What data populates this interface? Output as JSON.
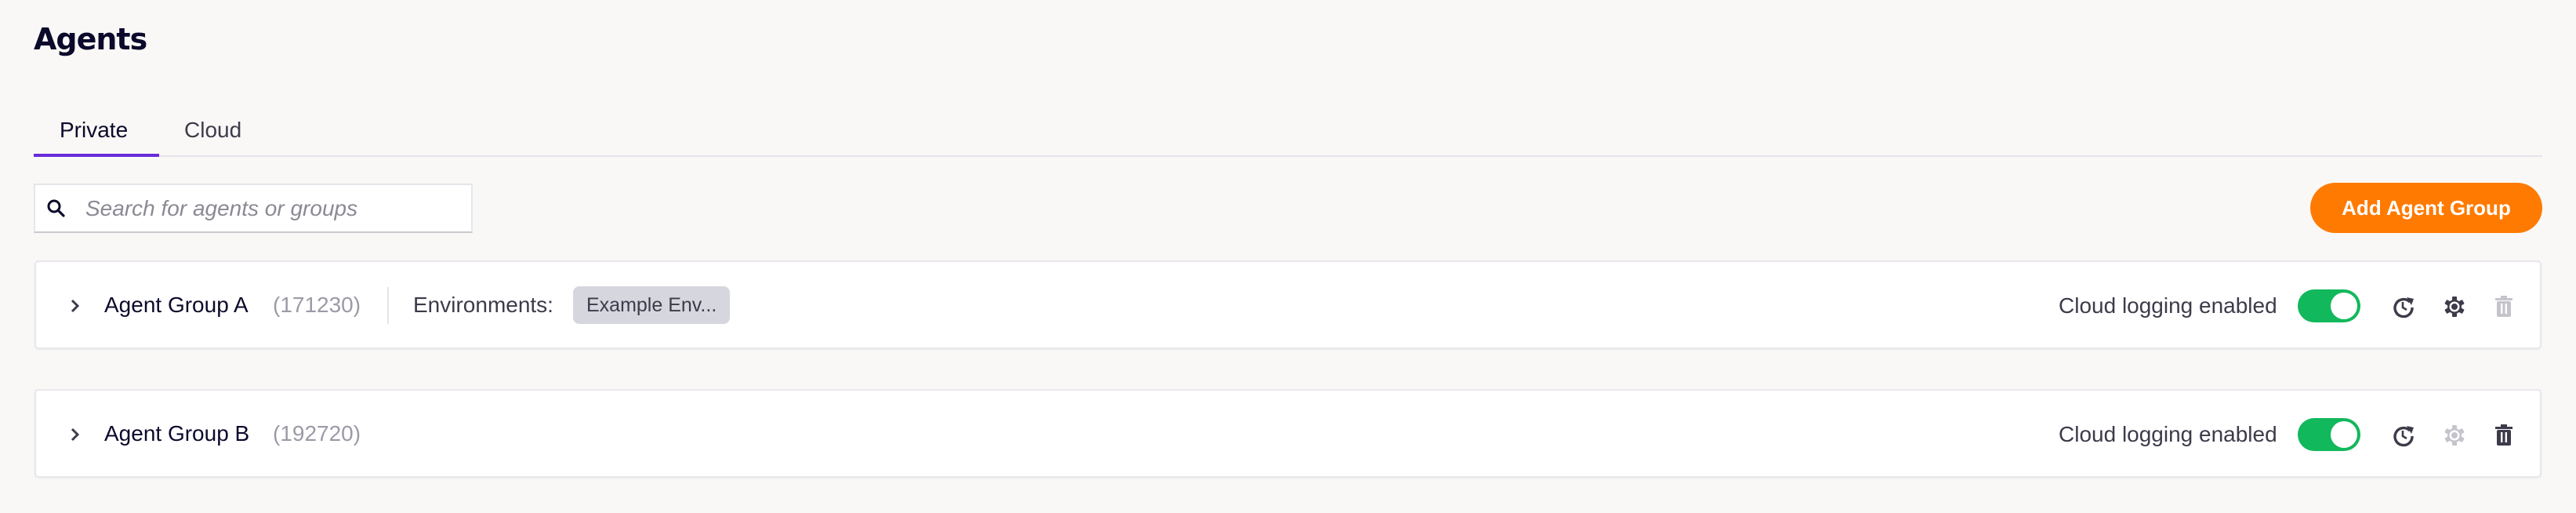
{
  "header": {
    "title": "Agents"
  },
  "tabs": [
    {
      "label": "Private",
      "active": true
    },
    {
      "label": "Cloud",
      "active": false
    }
  ],
  "search": {
    "placeholder": "Search for agents or groups",
    "value": "",
    "icon": "search-icon"
  },
  "toolbar": {
    "add_label": "Add Agent Group"
  },
  "colors": {
    "accent": "#6a2bd9",
    "primary_button": "#ff7a00",
    "toggle_on": "#12b85c",
    "chip_bg": "#d6d6de",
    "icon_active": "#3d3b4a",
    "icon_disabled": "#c5c4cc"
  },
  "groups": [
    {
      "name": "Agent Group A",
      "count": "(171230)",
      "environments_label": "Environments:",
      "environments": [
        "Example Env..."
      ],
      "logging_label": "Cloud logging enabled",
      "logging_enabled": true,
      "actions": {
        "history": "enabled",
        "settings": "enabled",
        "delete": "disabled"
      }
    },
    {
      "name": "Agent Group B",
      "count": "(192720)",
      "logging_label": "Cloud logging enabled",
      "logging_enabled": true,
      "actions": {
        "history": "enabled",
        "settings": "disabled",
        "delete": "enabled"
      }
    }
  ]
}
